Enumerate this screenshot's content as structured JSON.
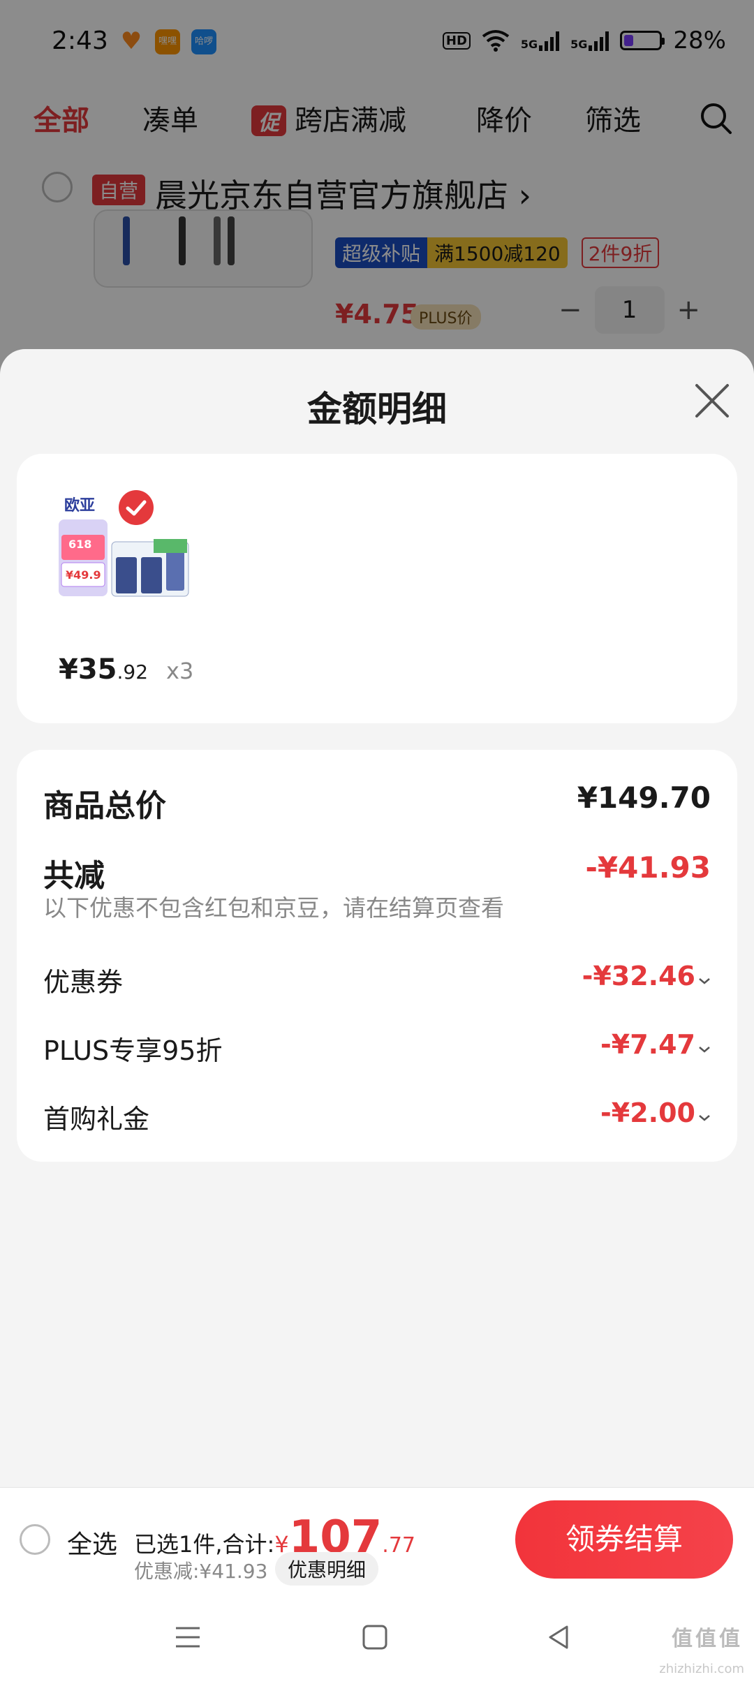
{
  "status_bar": {
    "time": "2:43",
    "app_icons": [
      {
        "name": "heart-app-icon",
        "label": "",
        "color": "#ff8a1e"
      },
      {
        "name": "app-icon-2",
        "label": "嘿嘿",
        "color": "#ff9500"
      },
      {
        "name": "app-icon-3",
        "label": "哈啰",
        "color": "#1e90ff"
      }
    ],
    "hd_label": "HD",
    "signal_1": "5G",
    "signal_2": "5G",
    "battery": "28%",
    "battery_level": 0.28
  },
  "filter_bar": {
    "all": "全部",
    "combine": "凑单",
    "promo_badge": "促",
    "cross_store": "跨店满减",
    "price_drop": "降价",
    "filter": "筛选"
  },
  "store": {
    "self_badge": "自营",
    "name": "晨光京东自营官方旗舰店",
    "chevron": "›"
  },
  "background_product": {
    "tag_super_a": "超级补贴",
    "tag_super_b": "满1500减120",
    "tag_discount": "2件9折",
    "price": "¥4.75",
    "plus_price": "PLUS价",
    "minus": "−",
    "quantity": "1",
    "plus": "+"
  },
  "sheet": {
    "title": "金额明细",
    "item": {
      "price_main": "¥35",
      "price_decimal": ".92",
      "quantity": "x3",
      "thumb_brand": "欧亚",
      "thumb_618": "618",
      "thumb_price": "¥49.9"
    },
    "summary": {
      "total_label": "商品总价",
      "total_value": "¥149.70",
      "reduce_label": "共减",
      "reduce_value": "-¥41.93",
      "note": "以下优惠不包含红包和京豆，请在结算页查看",
      "rows": [
        {
          "label": "优惠券",
          "value": "-¥32.46"
        },
        {
          "label": "PLUS专享95折",
          "value": "-¥7.47"
        },
        {
          "label": "首购礼金",
          "value": "-¥2.00"
        }
      ]
    }
  },
  "checkout": {
    "select_all": "全选",
    "selected_text": "已选1件,合计:",
    "currency": "¥",
    "total_int": "107",
    "total_dec": ".77",
    "discount_text": "优惠减:¥41.93",
    "detail_button": "优惠明细",
    "pay_button": "领券结算"
  },
  "watermark": {
    "text": "值值值",
    "url": "zhizhizhi.com"
  },
  "colors": {
    "accent": "#e4393c",
    "text": "#1a1a1a",
    "muted": "#888888"
  }
}
